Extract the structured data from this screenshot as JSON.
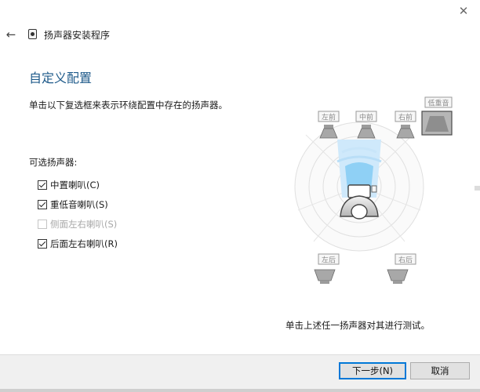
{
  "window": {
    "app_title": "扬声器安装程序",
    "close_glyph": "✕",
    "back_glyph": "←"
  },
  "page": {
    "title": "自定义配置",
    "description": "单击以下复选框来表示环绕配置中存在的扬声器。",
    "list_label": "可选扬声器:",
    "test_hint": "单击上述任一扬声器对其进行测试。"
  },
  "speakers": [
    {
      "label": "中置喇叭(C)",
      "checked": true,
      "enabled": true
    },
    {
      "label": "重低音喇叭(S)",
      "checked": true,
      "enabled": true
    },
    {
      "label": "侧面左右喇叭(S)",
      "checked": false,
      "enabled": false
    },
    {
      "label": "后面左右喇叭(R)",
      "checked": true,
      "enabled": true
    }
  ],
  "diagram": {
    "front_left": "左前",
    "center": "中前",
    "front_right": "右前",
    "subwoofer": "低重音",
    "rear_left": "左后",
    "rear_right": "右后"
  },
  "buttons": {
    "next": "下一步(N)",
    "cancel": "取消"
  },
  "colors": {
    "title_blue": "#1e5a8a",
    "primary_border": "#0078d7",
    "listener_zone": "#cfe9fb"
  }
}
